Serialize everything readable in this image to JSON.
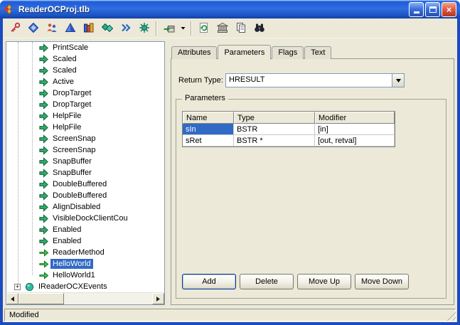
{
  "window": {
    "title": "ReaderOCProj.tlb"
  },
  "toolbar": {
    "items": [
      "key-icon",
      "interface-diamond-icon",
      "people-icon",
      "pyramid-icon",
      "books-icon",
      "diamonds-icon",
      "chevrons-icon",
      "gear-icon",
      "separator",
      "export-box-icon",
      "dropdown-arrow-icon",
      "separator",
      "refresh-icon",
      "building-icon",
      "copy-pages-icon",
      "binoculars-icon"
    ]
  },
  "tree": {
    "items": [
      {
        "label": "PrintScale",
        "icon": "property-icon",
        "level": 2
      },
      {
        "label": "Scaled",
        "icon": "property-icon",
        "level": 2
      },
      {
        "label": "Scaled",
        "icon": "property-icon",
        "level": 2
      },
      {
        "label": "Active",
        "icon": "property-icon",
        "level": 2
      },
      {
        "label": "DropTarget",
        "icon": "property-icon",
        "level": 2
      },
      {
        "label": "DropTarget",
        "icon": "property-icon",
        "level": 2
      },
      {
        "label": "HelpFile",
        "icon": "property-icon",
        "level": 2
      },
      {
        "label": "HelpFile",
        "icon": "property-icon",
        "level": 2
      },
      {
        "label": "ScreenSnap",
        "icon": "property-icon",
        "level": 2
      },
      {
        "label": "ScreenSnap",
        "icon": "property-icon",
        "level": 2
      },
      {
        "label": "SnapBuffer",
        "icon": "property-icon",
        "level": 2
      },
      {
        "label": "SnapBuffer",
        "icon": "property-icon",
        "level": 2
      },
      {
        "label": "DoubleBuffered",
        "icon": "property-icon",
        "level": 2
      },
      {
        "label": "DoubleBuffered",
        "icon": "property-icon",
        "level": 2
      },
      {
        "label": "AlignDisabled",
        "icon": "property-icon",
        "level": 2
      },
      {
        "label": "VisibleDockClientCou",
        "icon": "property-icon",
        "level": 2
      },
      {
        "label": "Enabled",
        "icon": "property-icon",
        "level": 2
      },
      {
        "label": "Enabled",
        "icon": "property-icon",
        "level": 2
      },
      {
        "label": "ReaderMethod",
        "icon": "method-icon",
        "level": 2
      },
      {
        "label": "HelloWorld",
        "icon": "method-icon",
        "level": 2,
        "selected": true
      },
      {
        "label": "HelloWorld1",
        "icon": "method-icon",
        "level": 2
      },
      {
        "label": "IReaderOCXEvents",
        "icon": "interface-icon",
        "level": 1,
        "expandable": true
      }
    ]
  },
  "tabs": [
    {
      "label": "Attributes",
      "active": false
    },
    {
      "label": "Parameters",
      "active": true
    },
    {
      "label": "Flags",
      "active": false
    },
    {
      "label": "Text",
      "active": false
    }
  ],
  "return_type": {
    "label": "Return Type:",
    "value": "HRESULT"
  },
  "parameters": {
    "group_title": "Parameters",
    "grid": {
      "headers": [
        "Name",
        "Type",
        "Modifier"
      ],
      "rows": [
        [
          "sIn",
          "BSTR",
          "[in]"
        ],
        [
          "sRet",
          "BSTR *",
          "[out, retval]"
        ]
      ],
      "selected_cell": {
        "row": 0,
        "col": 0
      }
    },
    "buttons": [
      "Add",
      "Delete",
      "Move Up",
      "Move Down"
    ],
    "default_button": "Add"
  },
  "status": {
    "text": "Modified"
  },
  "colors": {
    "selection": "#316ac5",
    "titlebar": "#2967e0",
    "window_border": "#1a4cc0"
  }
}
